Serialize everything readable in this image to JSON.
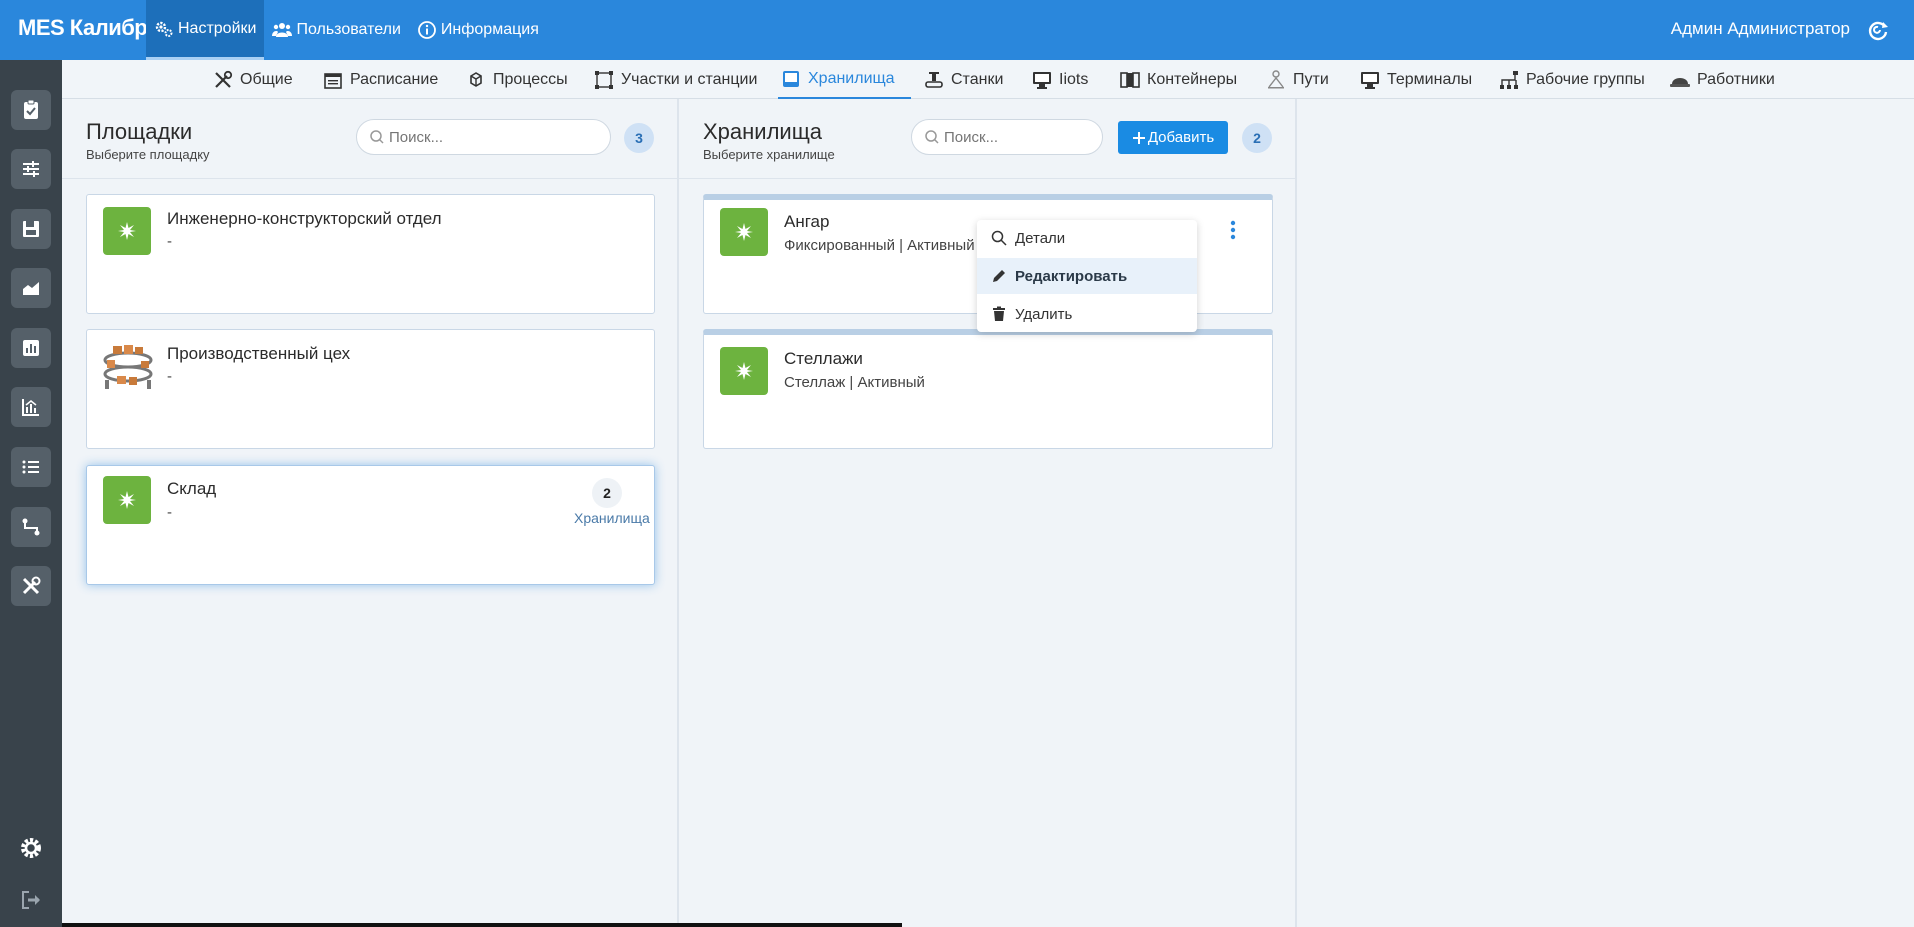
{
  "app": {
    "brand": "MES Калибр"
  },
  "topnav": [
    {
      "label": "Настройки",
      "icon": "gears-icon",
      "active": true
    },
    {
      "label": "Пользователи",
      "icon": "users-icon",
      "active": false
    },
    {
      "label": "Информация",
      "icon": "info-icon",
      "active": false
    }
  ],
  "user": {
    "name": "Админ Администратор"
  },
  "subnav": [
    {
      "label": "Общие",
      "icon": "tools-icon"
    },
    {
      "label": "Расписание",
      "icon": "calendar-icon"
    },
    {
      "label": "Процессы",
      "icon": "cubes-icon"
    },
    {
      "label": "Участки и станции",
      "icon": "vector-square-icon"
    },
    {
      "label": "Хранилища",
      "icon": "inbox-icon",
      "active": true
    },
    {
      "label": "Станки",
      "icon": "machine-icon"
    },
    {
      "label": "Iiots",
      "icon": "desktop-icon"
    },
    {
      "label": "Контейнеры",
      "icon": "containers-icon"
    },
    {
      "label": "Пути",
      "icon": "path-icon"
    },
    {
      "label": "Терминалы",
      "icon": "desktop-icon"
    },
    {
      "label": "Рабочие группы",
      "icon": "sitemap-icon"
    },
    {
      "label": "Работники",
      "icon": "hard-hat-icon"
    }
  ],
  "sites": {
    "title": "Площадки",
    "subtitle": "Выберите площадку",
    "search_placeholder": "Поиск...",
    "count": "3",
    "items": [
      {
        "title": "Инженерно-конструкторский отдел",
        "sub": "-"
      },
      {
        "title": "Производственный цех",
        "sub": "-"
      },
      {
        "title": "Склад",
        "sub": "-",
        "count": "2",
        "count_label": "Хранилища",
        "selected": true
      }
    ]
  },
  "storages": {
    "title": "Хранилища",
    "subtitle": "Выберите хранилище",
    "search_placeholder": "Поиск...",
    "add_label": "Добавить",
    "count": "2",
    "items": [
      {
        "title": "Ангар",
        "sub": "Фиксированный | Активный"
      },
      {
        "title": "Стеллажи",
        "sub": "Стеллаж | Активный"
      }
    ]
  },
  "context_menu": [
    {
      "label": "Детали",
      "icon": "search-icon"
    },
    {
      "label": "Редактировать",
      "icon": "pencil-icon",
      "hover": true
    },
    {
      "label": "Удалить",
      "icon": "trash-icon"
    }
  ],
  "colors": {
    "primary": "#2a87dc",
    "accent_green": "#6db33f",
    "sidebar": "#39434b"
  }
}
